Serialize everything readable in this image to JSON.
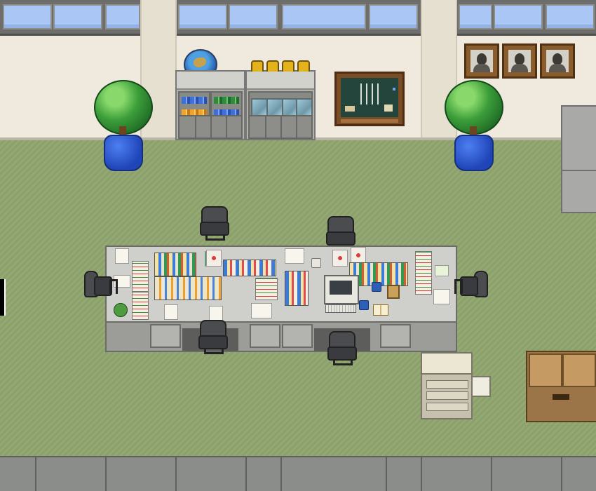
{
  "scene": {
    "colors": {
      "wall": "#efeadd",
      "floor": "#8fa56e",
      "window_glass": "#a9c6f5",
      "desk": "#c6c6c2",
      "plant_pot": "#1f45b8",
      "chalkboard": "#24453b"
    },
    "objects": {
      "windows": [
        "window",
        "window",
        "window",
        "window",
        "window",
        "window",
        "window",
        "window",
        "window",
        "window"
      ],
      "portraits": [
        "portrait",
        "portrait",
        "portrait"
      ],
      "trophies": [
        "trophy",
        "trophy",
        "trophy",
        "trophy"
      ],
      "plants": [
        "potted-plant",
        "potted-plant"
      ],
      "chairs": [
        "office-chair",
        "office-chair",
        "office-chair",
        "office-chair",
        "office-chair",
        "office-chair"
      ],
      "desks": [
        "desk",
        "desk",
        "desk",
        "desk"
      ],
      "fixtures": [
        "globe",
        "chalkboard",
        "bookcase",
        "glass-cabinet",
        "locker",
        "copier",
        "cardboard-boxes"
      ]
    }
  }
}
